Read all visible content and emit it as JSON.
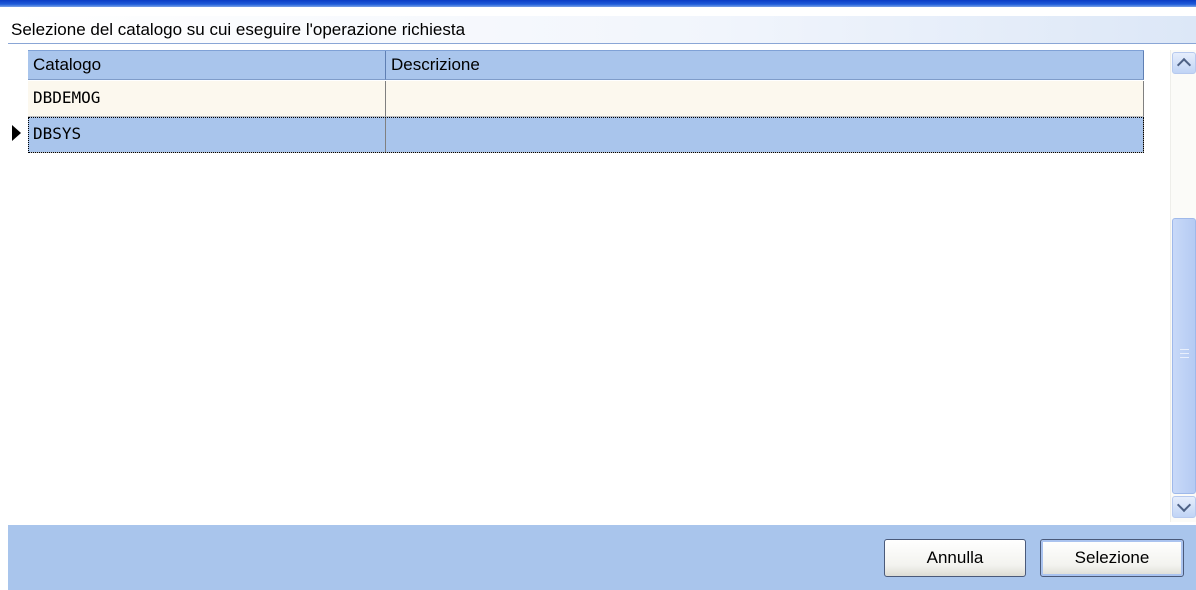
{
  "dialog": {
    "caption": "Selezione del catalogo su cui eseguire l'operazione richiesta"
  },
  "grid": {
    "columns": [
      "Catalogo",
      "Descrizione"
    ],
    "rows": [
      {
        "catalogo": "DBDEMOG",
        "descrizione": ""
      },
      {
        "catalogo": "DBSYS",
        "descrizione": "",
        "selected": true
      }
    ]
  },
  "footer": {
    "cancel_label": "Annulla",
    "select_label": "Selezione"
  },
  "icons": {
    "row_indicator": "current-row-arrow-icon",
    "scroll_up": "chevron-up-icon",
    "scroll_down": "chevron-down-icon"
  },
  "colors": {
    "header_bg": "#a9c5ec",
    "selected_row_bg": "#a9c5ec",
    "row_bg": "#fcf8ee",
    "footer_bg": "#a9c5ec"
  }
}
